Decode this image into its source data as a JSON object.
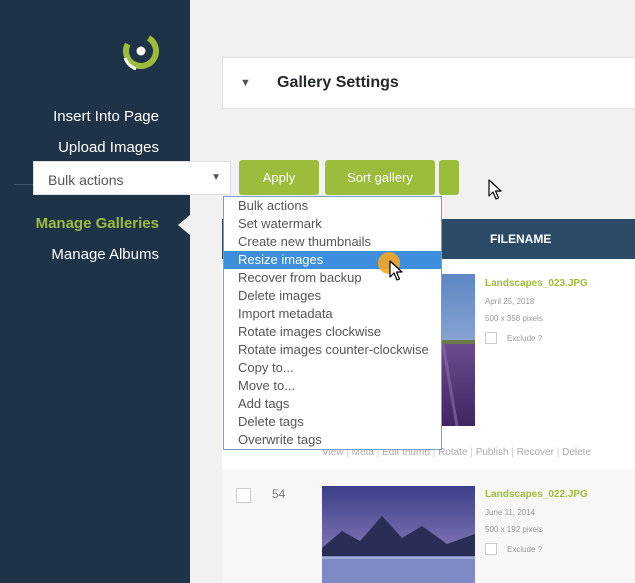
{
  "sidebar": {
    "nav_top": [
      {
        "label": "Insert Into Page"
      },
      {
        "label": "Upload Images"
      }
    ],
    "nav_bottom": [
      {
        "label": "Manage Galleries",
        "active": true
      },
      {
        "label": "Manage Albums"
      }
    ]
  },
  "gallery_settings": {
    "toggle_icon": "caret-down-icon",
    "title": "Gallery Settings"
  },
  "toolbar": {
    "bulk_select_value": "Bulk actions",
    "apply_label": "Apply",
    "sort_label": "Sort gallery"
  },
  "bulk_menu": {
    "highlighted_index": 4,
    "items": [
      "Bulk actions",
      "Set watermark",
      "Create new thumbnails",
      "Resize images",
      "Recover from backup",
      "Delete images",
      "Import metadata",
      "Rotate images clockwise",
      "Rotate images counter-clockwise",
      "Copy to...",
      "Move to...",
      "Add tags",
      "Delete tags",
      "Overwrite tags"
    ]
  },
  "table": {
    "header_filename": "FILENAME",
    "rows": [
      {
        "filename": "Landscapes_023.JPG",
        "date": "April 25, 2018",
        "dims": "500 x 358 pixels",
        "exclude": "Exclude ?"
      },
      {
        "number": "54",
        "filename": "Landscapes_022.JPG",
        "date": "June 11, 2014",
        "dims": "500 x 192 pixels",
        "exclude": "Exclude ?"
      }
    ],
    "row_actions": [
      "View",
      "Meta",
      "Edit thumb",
      "Rotate",
      "Publish",
      "Recover",
      "Delete"
    ]
  },
  "colors": {
    "sidebar_bg": "#1e3348",
    "accent": "#9cbd3c",
    "header_bg": "#2b4a66",
    "highlight": "#3d8fdd"
  }
}
